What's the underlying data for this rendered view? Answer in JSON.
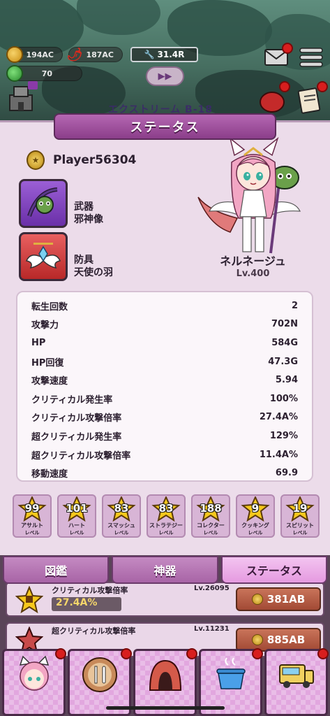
{
  "hud": {
    "coins": "194AC",
    "chili": "187AC",
    "gems": "70",
    "repair": "31.4R",
    "stage": "エクストリーム B-18"
  },
  "panel": {
    "title": "ステータス",
    "player_name": "Player56304",
    "weapon_label": "武器",
    "weapon_name": "邪神像",
    "armor_label": "防具",
    "armor_name": "天使の羽",
    "character_name": "ネルネージュ",
    "character_level": "Lv.400"
  },
  "stats": [
    {
      "label": "転生回数",
      "value": "2"
    },
    {
      "label": "攻撃力",
      "value": "702N"
    },
    {
      "label": "HP",
      "value": "584G"
    },
    {
      "label": "HP回復",
      "value": "47.3G"
    },
    {
      "label": "攻撃速度",
      "value": "5.94"
    },
    {
      "label": "クリティカル発生率",
      "value": "100%"
    },
    {
      "label": "クリティカル攻撃倍率",
      "value": "27.4A%"
    },
    {
      "label": "超クリティカル発生率",
      "value": "129%"
    },
    {
      "label": "超クリティカル攻撃倍率",
      "value": "11.4A%"
    },
    {
      "label": "移動速度",
      "value": "69.9"
    }
  ],
  "levels": [
    {
      "value": "99",
      "name": "アサルト",
      "sub": "レベル"
    },
    {
      "value": "101",
      "name": "ハート",
      "sub": "レベル"
    },
    {
      "value": "83",
      "name": "スマッシュ",
      "sub": "レベル"
    },
    {
      "value": "83",
      "name": "ストラテジー",
      "sub": "レベル"
    },
    {
      "value": "188",
      "name": "コレクター",
      "sub": "レベル"
    },
    {
      "value": "9",
      "name": "クッキング",
      "sub": "レベル"
    },
    {
      "value": "19",
      "name": "スピリット",
      "sub": "レベル"
    }
  ],
  "tabs": [
    {
      "label": "図鑑",
      "active": false
    },
    {
      "label": "神器",
      "active": false
    },
    {
      "label": "ステータス",
      "active": true
    }
  ],
  "list": [
    {
      "title": "クリティカル攻撃倍率",
      "level": "Lv.26095",
      "value": "27.4A%",
      "price": "381AB"
    },
    {
      "title": "超クリティカル攻撃倍率",
      "level": "Lv.11231",
      "value": "",
      "price": "885AB"
    }
  ],
  "colors": {
    "accent": "#a864a6",
    "panel": "#ecdcea",
    "star": "#f6c81c"
  }
}
